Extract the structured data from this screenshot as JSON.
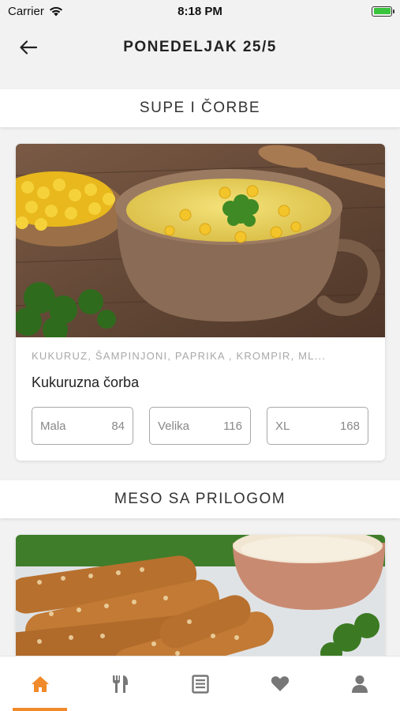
{
  "status_bar": {
    "carrier": "Carrier",
    "time": "8:18 PM",
    "battery_level": 1.0
  },
  "header": {
    "title": "PONEDELJAK 25/5"
  },
  "sections": [
    {
      "title": "SUPE I ČORBE",
      "items": [
        {
          "ingredients": "KUKURUZ, ŠAMPINJONI, PAPRIKA , KROMPIR, ML...",
          "name": "Kukuruzna čorba",
          "sizes": [
            {
              "label": "Mala",
              "price": "84"
            },
            {
              "label": "Velika",
              "price": "116"
            },
            {
              "label": "XL",
              "price": "168"
            }
          ]
        }
      ]
    },
    {
      "title": "MESO SA PRILOGOM"
    }
  ],
  "tab_bar": {
    "tabs": [
      {
        "icon": "home-icon",
        "active": true
      },
      {
        "icon": "fork-knife-icon",
        "active": false
      },
      {
        "icon": "menu-list-icon",
        "active": false
      },
      {
        "icon": "heart-icon",
        "active": false
      },
      {
        "icon": "user-icon",
        "active": false
      }
    ]
  },
  "colors": {
    "accent": "#f08a2a",
    "inactive_icon": "#777777",
    "background": "#f2f2f2"
  }
}
